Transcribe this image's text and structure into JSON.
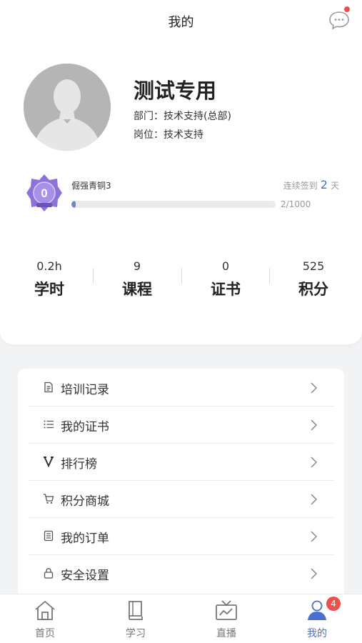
{
  "header": {
    "title": "我的"
  },
  "profile": {
    "name": "测试专用",
    "department": "部门：技术支持(总部)",
    "position": "岗位：技术支持"
  },
  "level": {
    "badge_number": "0",
    "name": "倔强青铜3",
    "progress_text": "2/1000",
    "progress_fraction": 0.002,
    "checkin_prefix": "连续签到",
    "checkin_days": "2",
    "checkin_suffix": "天"
  },
  "stats": [
    {
      "value": "0.2h",
      "label": "学时"
    },
    {
      "value": "9",
      "label": "课程"
    },
    {
      "value": "0",
      "label": "证书"
    },
    {
      "value": "525",
      "label": "积分"
    }
  ],
  "menu": [
    {
      "label": "培训记录",
      "icon": "document-icon"
    },
    {
      "label": "我的证书",
      "icon": "list-icon"
    },
    {
      "label": "排行榜",
      "icon": "ranking-v-icon"
    },
    {
      "label": "积分商城",
      "icon": "cart-icon"
    },
    {
      "label": "我的订单",
      "icon": "order-icon"
    },
    {
      "label": "安全设置",
      "icon": "lock-icon"
    }
  ],
  "tabs": [
    {
      "label": "首页",
      "icon": "home-icon"
    },
    {
      "label": "学习",
      "icon": "book-icon"
    },
    {
      "label": "直播",
      "icon": "tv-icon"
    },
    {
      "label": "我的",
      "icon": "user-icon",
      "badge": "4"
    }
  ],
  "colors": {
    "accent": "#4a6fd1",
    "badge_red": "#f0504b",
    "level_purple": "#8d72d8",
    "progress": "#6f86c9"
  }
}
